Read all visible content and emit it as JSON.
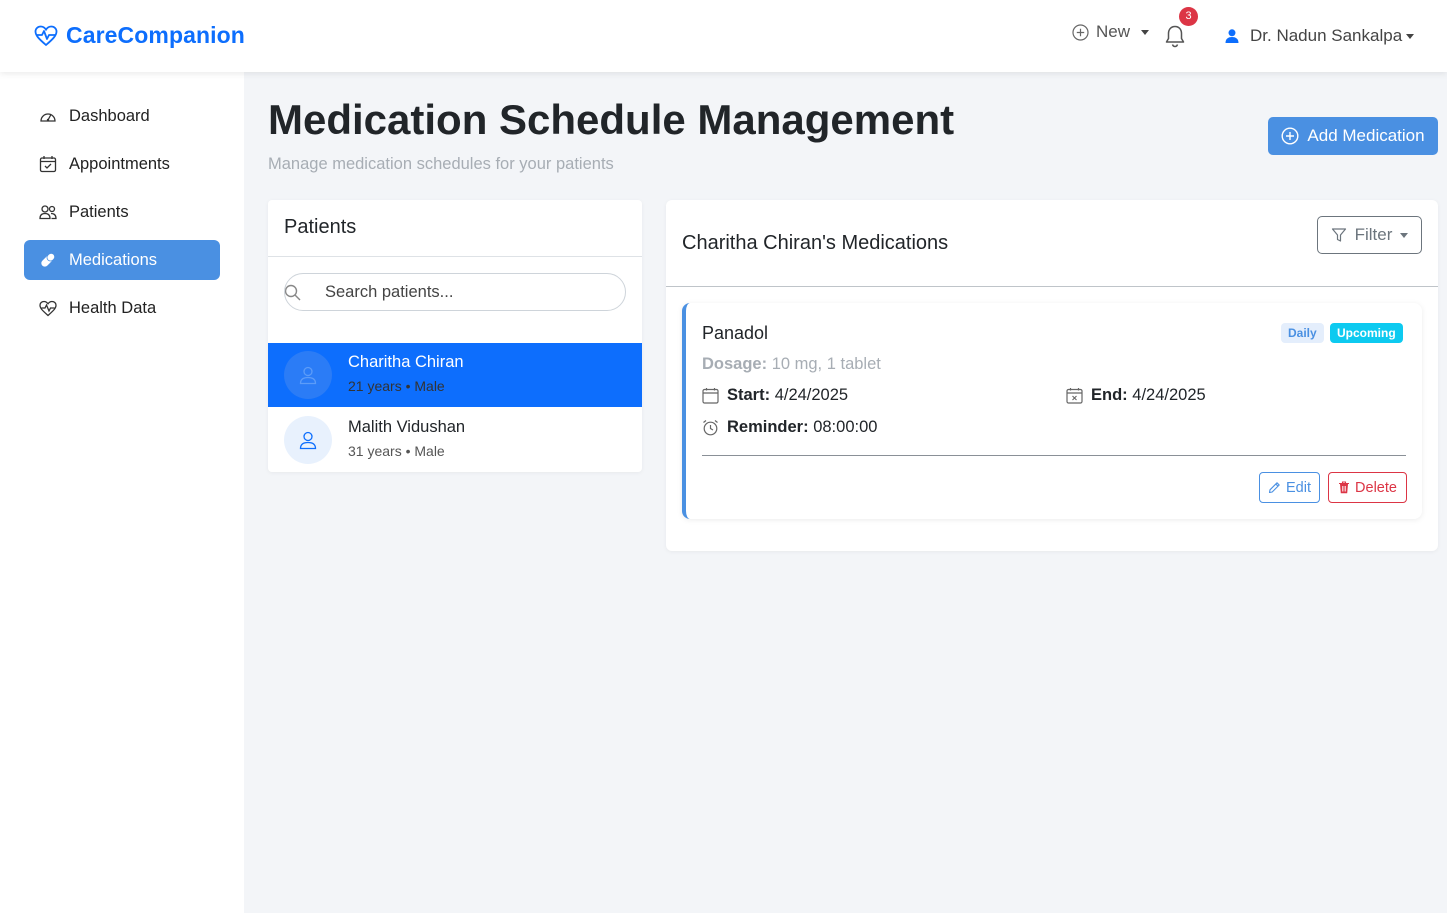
{
  "app": {
    "brand": "CareCompanion",
    "brand_icon": "heart-pulse-icon",
    "accent_color": "#0d6efd"
  },
  "navbar": {
    "new_label": "New",
    "notification_count": "3",
    "user_name": "Dr. Nadun Sankalpa"
  },
  "sidebar": {
    "items": [
      {
        "label": "Dashboard",
        "icon": "speedometer-icon",
        "active": false
      },
      {
        "label": "Appointments",
        "icon": "calendar-check-icon",
        "active": false
      },
      {
        "label": "Patients",
        "icon": "people-icon",
        "active": false
      },
      {
        "label": "Medications",
        "icon": "capsule-icon",
        "active": true
      },
      {
        "label": "Health Data",
        "icon": "heart-pulse-icon",
        "active": false
      }
    ]
  },
  "page": {
    "title": "Medication Schedule Management",
    "subtitle": "Manage medication schedules for your patients",
    "add_button": "Add Medication"
  },
  "patients_panel": {
    "title": "Patients",
    "search_placeholder": "Search patients...",
    "patients": [
      {
        "name": "Charitha Chiran",
        "meta": "21 years • Male",
        "selected": true
      },
      {
        "name": "Malith Vidushan",
        "meta": "31 years • Male",
        "selected": false
      }
    ]
  },
  "medications_panel": {
    "title": "Charitha Chiran's Medications",
    "filter_label": "Filter",
    "medications": [
      {
        "name": "Panadol",
        "frequency_badge": "Daily",
        "status_badge": "Upcoming",
        "dosage_label": "Dosage:",
        "dosage_value": "10 mg, 1 tablet",
        "start_label": "Start:",
        "start_value": "4/24/2025",
        "end_label": "End:",
        "end_value": "4/24/2025",
        "reminder_label": "Reminder:",
        "reminder_value": "08:00:00",
        "edit_label": "Edit",
        "delete_label": "Delete"
      }
    ]
  }
}
